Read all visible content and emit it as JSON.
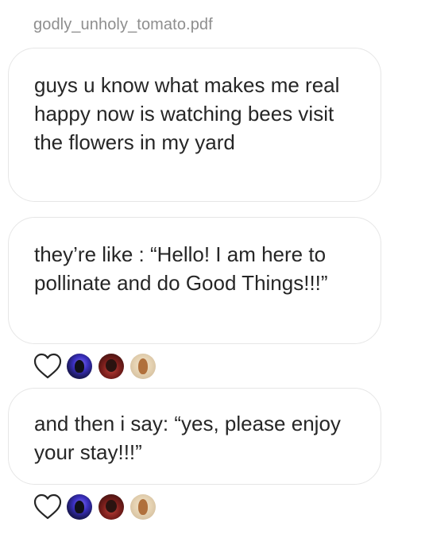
{
  "thread": {
    "sender_name": "godly_unholy_tomato.pdf"
  },
  "messages": [
    {
      "text": "guys u know what makes me real happy now is watching bees visit the flowers in my yard"
    },
    {
      "text": "they’re like : “Hello! I am here to pollinate and do Good Things!!!”"
    },
    {
      "text": "and then i say: “yes, please enjoy your stay!!!”"
    }
  ],
  "reactions": [
    {
      "heart_icon": "heart-outline-icon",
      "avatars": [
        "avatar-blue-portrait",
        "avatar-red-portrait",
        "avatar-light-portrait"
      ]
    },
    {
      "heart_icon": "heart-outline-icon",
      "avatars": [
        "avatar-blue-portrait",
        "avatar-red-portrait",
        "avatar-light-portrait"
      ]
    }
  ],
  "colors": {
    "text": "#262626",
    "sender": "#8e8e8e",
    "bubble_border": "#e6e6e6",
    "background": "#ffffff"
  }
}
